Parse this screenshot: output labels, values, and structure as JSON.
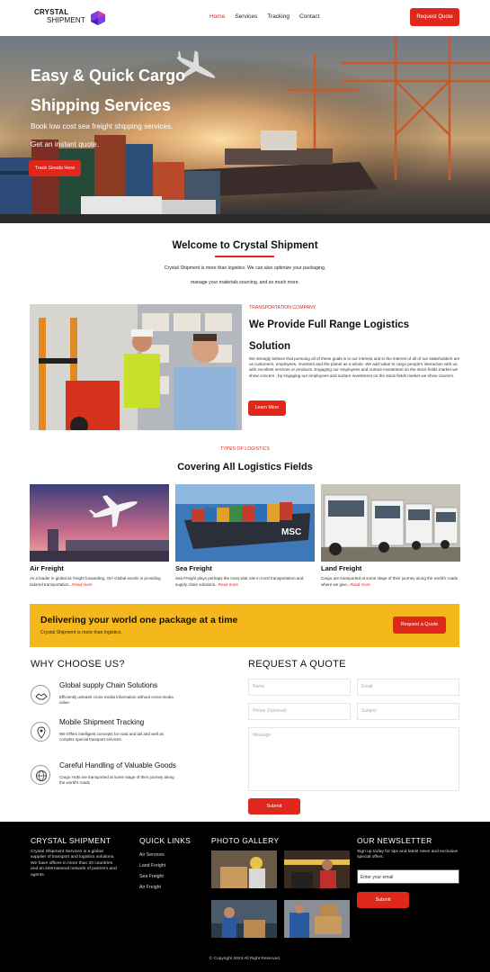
{
  "brand": {
    "name": "CRYSTAL",
    "sub": "SHIPMENT",
    "accent": "#e0271c",
    "mark_color": "#7b3fe4"
  },
  "nav": {
    "items": [
      "Home",
      "Services",
      "Tracking",
      "Contact"
    ],
    "active": "Home",
    "cta": "Request Quote"
  },
  "hero": {
    "title": "Easy & Quick Cargo Shipping Services",
    "line1": "Book low cost sea freight shipping services.",
    "line2": "Get an instant quote.",
    "button": "Track Goods Here"
  },
  "welcome": {
    "title": "Welcome to Crystal Shipment",
    "line1": "Crystal Shipment is more than logistics. We can also optimize your packaging,",
    "line2": "manage your materials sourcing, and so much more."
  },
  "about": {
    "kicker": "TRANSPORTATION COMPANY",
    "title": "We Provide Full Range Logistics Solution",
    "text": "We strongly believe that pursuing all of these goals is in our interest and in the interest of all of our stakeholders are us customers, employees, investors and the planet as a whole. We add value to cargo people's interaction with us, with excellent services or products. Engaging our employees and nurture investment on the stock fields market we show concern , by engaging our employees and nurture investment on the stock fields market we show concern.",
    "button": "Learn More"
  },
  "types": {
    "kicker": "TYPES OF LOGISTICS",
    "title": "Covering All Logistics Fields",
    "cards": [
      {
        "title": "Air Freight",
        "text": "As a leader in global air freight forwarding, OIA Global excels in providing tailored transportation...",
        "more": "Read more"
      },
      {
        "title": "Sea Freight",
        "text": "Sea Freight plays perhaps the most vital role in most transportation and supply chain solutions...",
        "more": "Read more"
      },
      {
        "title": "Land Freight",
        "text": "Cargo are transported at some stage of their journey along the world's roads where we give...",
        "more": "Read more"
      }
    ]
  },
  "banner": {
    "title": "Delivering your world one package at a time",
    "text": "Crystal Shipment is more than logistics.",
    "button": "Request a Quote",
    "color": "#f5b81c"
  },
  "why": {
    "title": "WHY CHOOSE US?",
    "features": [
      {
        "title": "Global supply Chain Solutions",
        "text": "Efficiently unleash cross-media information without cross-media value.",
        "icon": "handshake-icon"
      },
      {
        "title": "Mobile Shipment Tracking",
        "text": "We Offers intelligent concepts for road and tail and well as complex special transport services.",
        "icon": "location-pin-icon"
      },
      {
        "title": "Careful Handling of Valuable Goods",
        "text": "Cargo HUB are transported at some stage of their journey along the world's roads",
        "icon": "globe-icon"
      }
    ]
  },
  "quote": {
    "title": "REQUEST A QUOTE",
    "name": "Name",
    "email": "Email",
    "phone": "Phone (Optional)",
    "subject": "Subject",
    "message": "Message",
    "button": "Submit"
  },
  "footer": {
    "about_title": "CRYSTAL SHIPMENT",
    "about_text": "Crystal Shipment Services is a global supplier of transport and logistics solutions. We have offices in more than 20 countries and an international network of partners and agents.",
    "links_title": "QUICK LINKS",
    "links": [
      "Air Services",
      "Land Freight",
      "Sea Freight",
      "Air Freight"
    ],
    "gallery_title": "PHOTO GALLERY",
    "news_title": "OUR NEWSLETTER",
    "news_text": "Sign up today for tips and latest news and exclusive special offers.",
    "news_placeholder": "Enter your email",
    "news_button": "Submit",
    "copyright": "© Copyright 2023 All Right Reserved."
  }
}
